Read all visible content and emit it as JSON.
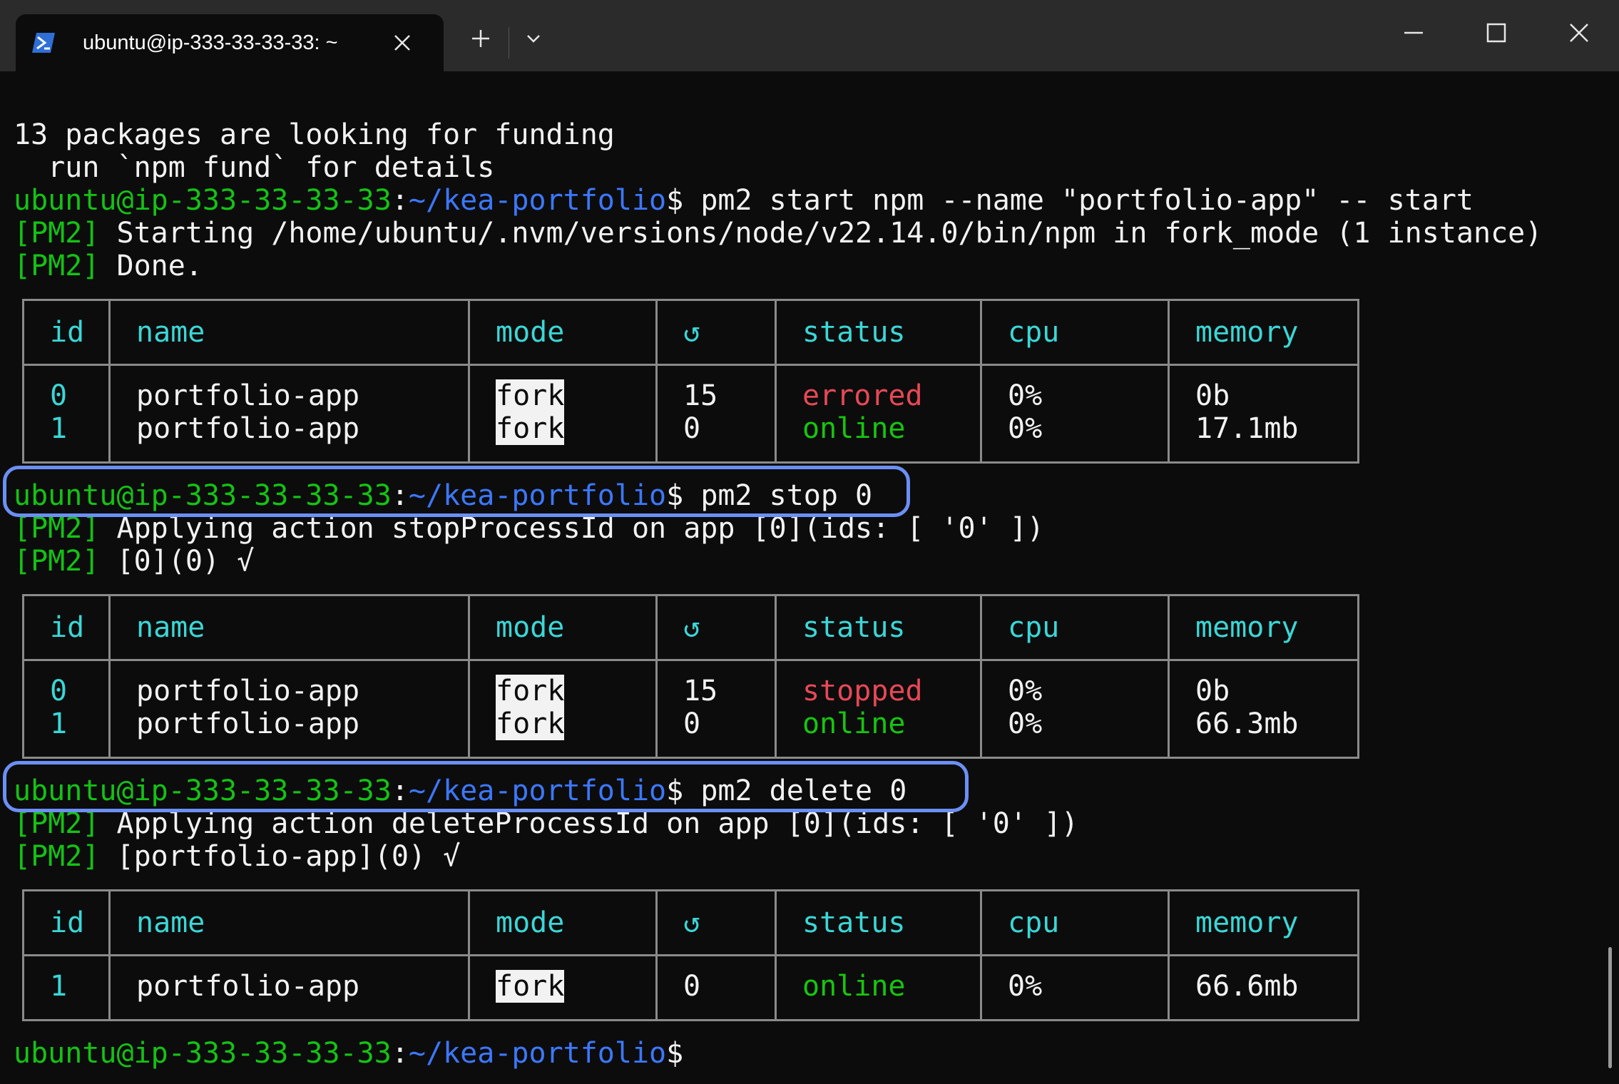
{
  "window": {
    "tab_title": "ubuntu@ip-333-33-33-33: ~",
    "new_tab_symbol": "+",
    "icons": [
      "powershell-icon",
      "close-icon",
      "plus-icon",
      "chevron-down-icon",
      "minimize-icon",
      "maximize-icon",
      "close-window-icon"
    ]
  },
  "prompt": {
    "user_host": "ubuntu@ip-333-33-33-33",
    "colon": ":",
    "path": "~/kea-portfolio",
    "dollar": "$"
  },
  "lines": {
    "funding": "13 packages are looking for funding",
    "fund_hint": "  run `npm fund` for details",
    "cmd_start": " pm2 start npm --name \"portfolio-app\" -- start",
    "pm2_tag": "[PM2]",
    "starting": " Starting /home/ubuntu/.nvm/versions/node/v22.14.0/bin/npm in fork_mode (1 instance)",
    "done": " Done.",
    "cmd_stop": " pm2 stop 0",
    "applying_stop": " Applying action stopProcessId on app [0](ids: [ '0' ])",
    "stop_result": " [0](0) √",
    "cmd_delete": " pm2 delete 0",
    "applying_delete": " Applying action deleteProcessId on app [0](ids: [ '0' ])",
    "delete_result": " [portfolio-app](0) √"
  },
  "table_headers": [
    "id",
    "name",
    "mode",
    "↺",
    "status",
    "cpu",
    "memory"
  ],
  "tables": [
    {
      "rows": [
        {
          "id": "0",
          "name": "portfolio-app",
          "mode": "fork",
          "restarts": "15",
          "status": "errored",
          "cpu": "0%",
          "memory": "0b"
        },
        {
          "id": "1",
          "name": "portfolio-app",
          "mode": "fork",
          "restarts": "0",
          "status": "online",
          "cpu": "0%",
          "memory": "17.1mb"
        }
      ]
    },
    {
      "rows": [
        {
          "id": "0",
          "name": "portfolio-app",
          "mode": "fork",
          "restarts": "15",
          "status": "stopped",
          "cpu": "0%",
          "memory": "0b"
        },
        {
          "id": "1",
          "name": "portfolio-app",
          "mode": "fork",
          "restarts": "0",
          "status": "online",
          "cpu": "0%",
          "memory": "66.3mb"
        }
      ]
    },
    {
      "rows": [
        {
          "id": "1",
          "name": "portfolio-app",
          "mode": "fork",
          "restarts": "0",
          "status": "online",
          "cpu": "0%",
          "memory": "66.6mb"
        }
      ]
    }
  ],
  "colors": {
    "prompt_user": "#13c313",
    "prompt_path": "#3b78ff",
    "header": "#3ad7d7",
    "errored": "#e74856",
    "online": "#16c60c",
    "highlight": "#6b8ff5"
  }
}
